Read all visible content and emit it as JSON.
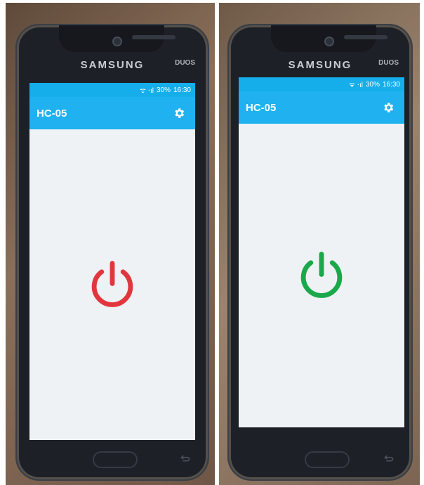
{
  "left_phone": {
    "brand": "SAMSUNG",
    "model_badge": "DUOS",
    "status": {
      "signal": "ᯤ ‧ıl",
      "battery": "30%",
      "time": "16:30"
    },
    "app_title": "HC-05",
    "power_icon": "power-icon",
    "power_state": "off",
    "power_color": "#e2363f"
  },
  "right_phone": {
    "brand": "SAMSUNG",
    "model_badge": "DUOS",
    "status": {
      "signal": "ᯤ ‧ıl",
      "battery": "30%",
      "time": "16:30"
    },
    "app_title": "HC-05",
    "power_icon": "power-icon",
    "power_state": "on",
    "power_color": "#1aa94a"
  },
  "colors": {
    "appbar": "#1fb1f0",
    "statusbar": "#16aeea",
    "screen_bg": "#eef2f4"
  }
}
